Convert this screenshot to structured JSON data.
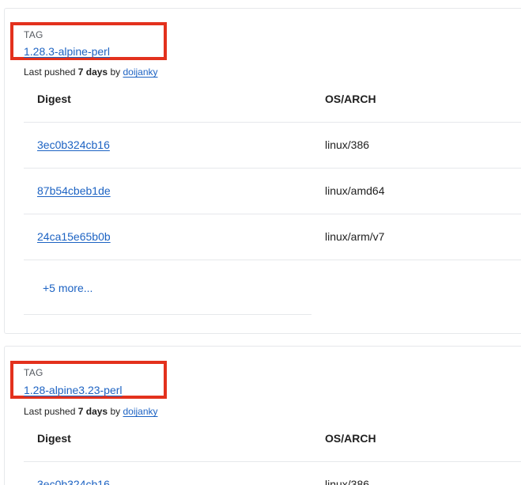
{
  "tags": [
    {
      "tag_label": "TAG",
      "tag_name": "1.28.3-alpine-perl",
      "pushed_prefix": "Last pushed",
      "pushed_when": "7 days",
      "pushed_by": "by",
      "pushed_user": "doijanky",
      "headers": {
        "digest": "Digest",
        "osarch": "OS/ARCH"
      },
      "rows": [
        {
          "digest": "3ec0b324cb16",
          "osarch": "linux/386"
        },
        {
          "digest": "87b54cbeb1de",
          "osarch": "linux/amd64"
        },
        {
          "digest": "24ca15e65b0b",
          "osarch": "linux/arm/v7"
        }
      ],
      "more": "+5 more..."
    },
    {
      "tag_label": "TAG",
      "tag_name": "1.28-alpine3.23-perl",
      "pushed_prefix": "Last pushed",
      "pushed_when": "7 days",
      "pushed_by": "by",
      "pushed_user": "doijanky",
      "headers": {
        "digest": "Digest",
        "osarch": "OS/ARCH"
      },
      "rows": [
        {
          "digest": "3ec0b324cb16",
          "osarch": "linux/386"
        }
      ]
    }
  ],
  "colors": {
    "link": "#1d63c3",
    "highlight": "#e3311d",
    "border": "#e6e8eb"
  }
}
